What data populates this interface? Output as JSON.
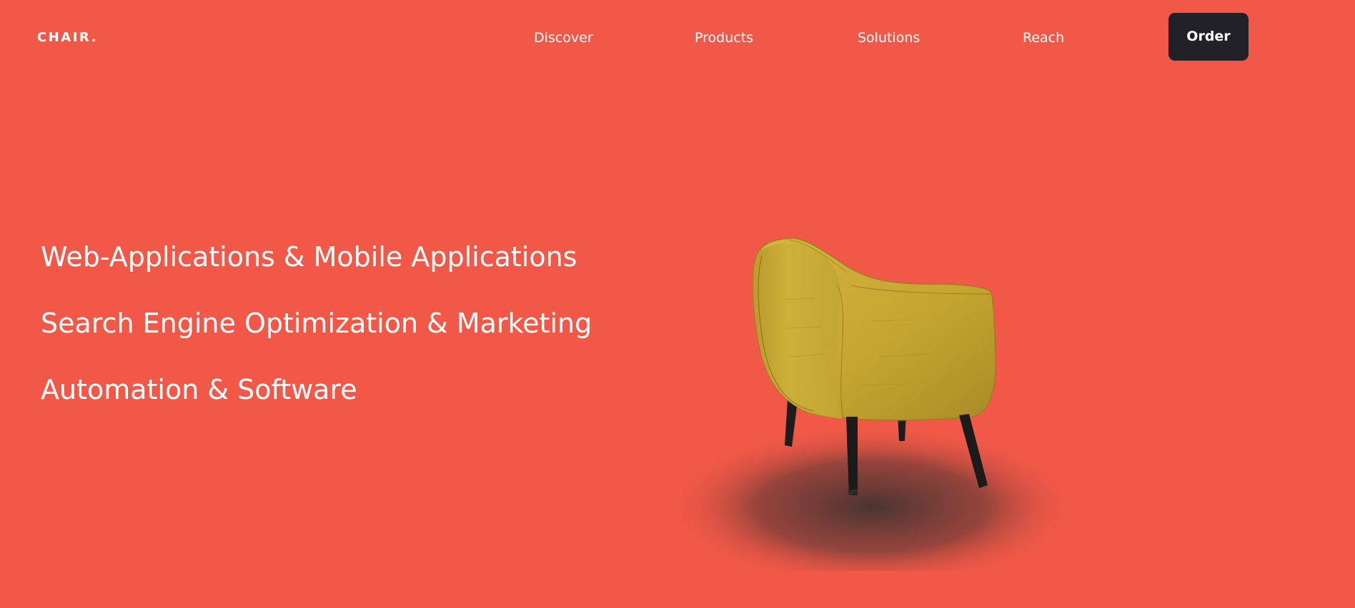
{
  "brand": {
    "logo_text": "CHAIR."
  },
  "nav": {
    "items": [
      {
        "label": "Discover"
      },
      {
        "label": "Products"
      },
      {
        "label": "Solutions"
      },
      {
        "label": "Reach"
      }
    ],
    "cta_label": "Order"
  },
  "hero": {
    "lines": [
      "Web-Applications & Mobile Applications",
      "Search Engine Optimization & Marketing",
      "Automation & Software"
    ],
    "image_icon": "armchair-illustration"
  },
  "colors": {
    "background": "#f15847",
    "button": "#212127",
    "text": "#ffffff",
    "chair": "#c9aa35"
  }
}
